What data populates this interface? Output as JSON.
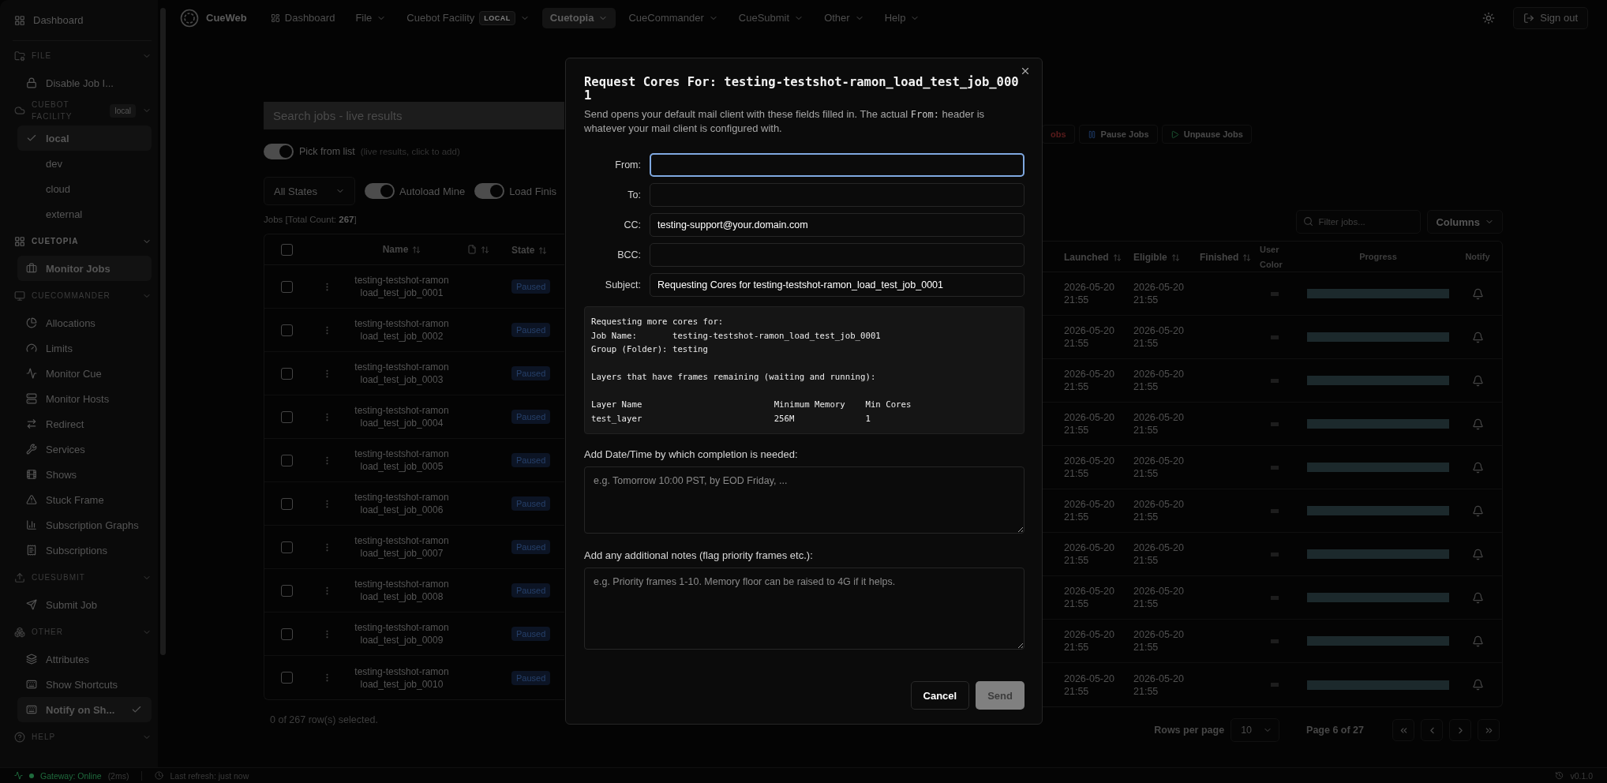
{
  "sidebar": {
    "dashboard": "Dashboard",
    "sections": [
      {
        "title": "FILE",
        "active": false,
        "items": [
          {
            "kind": "link",
            "label": "Disable Job I...",
            "selected": false
          }
        ]
      },
      {
        "title": "CUEBOT FACILITY",
        "active": false,
        "badge": "local",
        "items": [
          {
            "kind": "option",
            "label": "local",
            "selected": true
          },
          {
            "kind": "option",
            "label": "dev",
            "selected": false
          },
          {
            "kind": "option",
            "label": "cloud",
            "selected": false
          },
          {
            "kind": "option",
            "label": "external",
            "selected": false
          }
        ]
      },
      {
        "title": "CUETOPIA",
        "active": true,
        "items": [
          {
            "kind": "link",
            "label": "Monitor Jobs",
            "selected": true
          }
        ]
      },
      {
        "title": "CUECOMMANDER",
        "active": false,
        "items": [
          {
            "kind": "link",
            "label": "Allocations",
            "selected": false
          },
          {
            "kind": "link",
            "label": "Limits",
            "selected": false
          },
          {
            "kind": "link",
            "label": "Monitor Cue",
            "selected": false
          },
          {
            "kind": "link",
            "label": "Monitor Hosts",
            "selected": false
          },
          {
            "kind": "link",
            "label": "Redirect",
            "selected": false
          },
          {
            "kind": "link",
            "label": "Services",
            "selected": false
          },
          {
            "kind": "link",
            "label": "Shows",
            "selected": false
          },
          {
            "kind": "link",
            "label": "Stuck Frame",
            "selected": false
          },
          {
            "kind": "link",
            "label": "Subscription Graphs",
            "selected": false
          },
          {
            "kind": "link",
            "label": "Subscriptions",
            "selected": false
          }
        ]
      },
      {
        "title": "CUESUBMIT",
        "active": false,
        "items": [
          {
            "kind": "link",
            "label": "Submit Job",
            "selected": false
          }
        ]
      },
      {
        "title": "OTHER",
        "active": false,
        "items": [
          {
            "kind": "link",
            "label": "Attributes",
            "selected": false
          },
          {
            "kind": "link",
            "label": "Show Shortcuts",
            "selected": false
          },
          {
            "kind": "toggle",
            "label": "Notify on Sh...",
            "selected": true,
            "checked": true
          }
        ]
      },
      {
        "title": "HELP",
        "active": false
      }
    ]
  },
  "topbar": {
    "brand": "CueWeb",
    "items": [
      {
        "kind": "link",
        "label": "Dashboard",
        "selected": false
      },
      {
        "kind": "menu",
        "label": "File",
        "selected": false
      },
      {
        "kind": "facility",
        "label": "Cuebot Facility",
        "badge": "LOCAL",
        "selected": false
      },
      {
        "kind": "menu",
        "label": "Cuetopia",
        "selected": true
      },
      {
        "kind": "menu",
        "label": "CueCommander",
        "selected": false
      },
      {
        "kind": "menu",
        "label": "CueSubmit",
        "selected": false
      },
      {
        "kind": "menu",
        "label": "Other",
        "selected": false
      },
      {
        "kind": "menu",
        "label": "Help",
        "selected": false
      }
    ],
    "sign_out": "Sign out"
  },
  "search": {
    "placeholder": "Search jobs - live results"
  },
  "pick_toggle": {
    "label": "Pick from list",
    "hint": "(live results, click to add)",
    "on": true
  },
  "filters": {
    "state_select": "All States",
    "toggles": [
      {
        "label": "Autoload Mine",
        "on": true
      },
      {
        "label": "Load Finis",
        "on": true
      }
    ]
  },
  "jobs_count": "Jobs [Total Count: **267**]",
  "actions": [
    {
      "kind": "kill",
      "label": "obs"
    },
    {
      "kind": "pause",
      "label": "Pause Jobs"
    },
    {
      "kind": "unpause",
      "label": "Unpause Jobs"
    }
  ],
  "filter": {
    "placeholder": "Filter jobs..."
  },
  "columns_button": "Columns",
  "table": {
    "header_checked": false,
    "columns": [
      {
        "label": "Name",
        "sortable": true
      },
      {
        "label": "State",
        "sortable": true
      },
      {
        "label": "Launched",
        "sortable": true
      },
      {
        "label": "Eligible",
        "sortable": true
      },
      {
        "label": "Finished",
        "sortable": true
      },
      {
        "label": "User Color",
        "sortable": false
      },
      {
        "label": "Progress",
        "sortable": false
      },
      {
        "label": "Notify",
        "sortable": false
      }
    ],
    "rows": [
      {
        "checked": false,
        "name": "testing-testshot-ramon load_test_job_0001",
        "state": "Paused",
        "launched": "2026-05-20 21:55",
        "eligible": "2026-05-20 21:55",
        "level": 0
      },
      {
        "checked": false,
        "name": "testing-testshot-ramon load_test_job_0002",
        "state": "Paused",
        "launched": "2026-05-20 21:55",
        "eligible": "2026-05-20 21:55",
        "level": 0
      },
      {
        "checked": false,
        "name": "testing-testshot-ramon load_test_job_0003",
        "state": "Paused",
        "launched": "2026-05-20 21:55",
        "eligible": "2026-05-20 21:55",
        "level": 0
      },
      {
        "checked": false,
        "name": "testing-testshot-ramon load_test_job_0004",
        "state": "Paused",
        "launched": "2026-05-20 21:55",
        "eligible": "2026-05-20 21:55",
        "level": 0
      },
      {
        "checked": false,
        "name": "testing-testshot-ramon load_test_job_0005",
        "state": "Paused",
        "launched": "2026-05-20 21:55",
        "eligible": "2026-05-20 21:55",
        "level": 0
      },
      {
        "checked": false,
        "name": "testing-testshot-ramon load_test_job_0006",
        "state": "Paused",
        "launched": "2026-05-20 21:55",
        "eligible": "2026-05-20 21:55",
        "level": 0
      },
      {
        "checked": false,
        "name": "testing-testshot-ramon load_test_job_0007",
        "state": "Paused",
        "launched": "2026-05-20 21:55",
        "eligible": "2026-05-20 21:55",
        "level": 0
      },
      {
        "checked": false,
        "name": "testing-testshot-ramon load_test_job_0008",
        "state": "Paused",
        "launched": "2026-05-20 21:55",
        "eligible": "2026-05-20 21:55",
        "level": 0
      },
      {
        "checked": false,
        "name": "testing-testshot-ramon load_test_job_0009",
        "state": "Paused",
        "launched": "2026-05-20 21:55",
        "eligible": "2026-05-20 21:55",
        "level": 0
      },
      {
        "checked": false,
        "name": "testing-testshot-ramon load_test_job_0010",
        "state": "Paused",
        "launched": "2026-05-20 21:55",
        "eligible": "2026-05-20 21:55",
        "level": 0
      }
    ]
  },
  "selection_text": "0 of 267 row(s) selected.",
  "pagination": {
    "rows_per_page_label": "Rows per page",
    "rows_per_page": "10",
    "page": "Page 6 of 27"
  },
  "status_bar": {
    "gateway": "Gateway: Online",
    "online": true,
    "latency": "(2ms)",
    "last_refresh": "Last refresh: just now",
    "version": "v0.1.0"
  },
  "dialog": {
    "title": "Request Cores For: testing-testshot-ramon_load_test_job_0001",
    "description": {
      "before": "Send opens your default mail client with these fields filled in. The actual ",
      "code": "From:",
      "after": " header is whatever your mail client is configured with."
    },
    "fields": [
      {
        "label": "From:",
        "focused": true
      },
      {
        "label": "To:",
        "focused": false
      },
      {
        "label": "CC:",
        "value": "testing-support@your.domain.com",
        "focused": false
      },
      {
        "label": "BCC:",
        "focused": false
      },
      {
        "label": "Subject:",
        "value": "Requesting Cores for testing-testshot-ramon_load_test_job_0001",
        "focused": false
      }
    ],
    "body": "Requesting more cores for:\nJob Name:       testing-testshot-ramon_load_test_job_0001\nGroup (Folder): testing\n\nLayers that have frames remaining (waiting and running):\n\nLayer Name                          Minimum Memory    Min Cores\ntest_layer                          256M              1",
    "deadline": {
      "label": "Add Date/Time by which completion is needed:",
      "placeholder": "e.g. Tomorrow 10:00 PST, by EOD Friday, ..."
    },
    "notes": {
      "label": "Add any additional notes (flag priority frames etc.):",
      "placeholder": "e.g. Priority frames 1-10. Memory floor can be raised to 4G if it helps."
    },
    "cancel": "Cancel",
    "send": {
      "label": "Send",
      "disabled": true
    }
  }
}
